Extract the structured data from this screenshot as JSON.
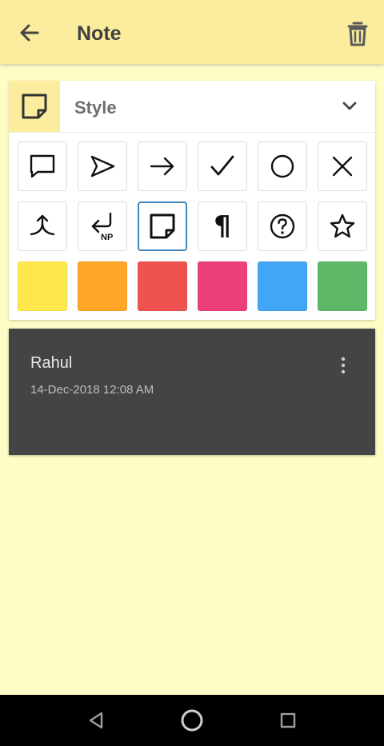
{
  "appbar": {
    "title": "Note",
    "back_icon": "arrow-left-icon",
    "delete_icon": "trash-icon"
  },
  "style_panel": {
    "label": "Style",
    "selected_icon": "sticky-note-icon",
    "icons_row1": [
      "speech-bubble-icon",
      "navigation-arrow-icon",
      "arrow-right-icon",
      "check-icon",
      "circle-icon",
      "close-icon"
    ],
    "icons_row2": [
      "merge-icon",
      "return-np-icon",
      "sticky-note-icon",
      "paragraph-icon",
      "question-circle-icon",
      "star-icon"
    ],
    "np_text": "NP",
    "pilcrow": "¶",
    "colors": [
      "#FFE84E",
      "#FFA629",
      "#EF5350",
      "#EC407A",
      "#42A5F5",
      "#5FB868"
    ]
  },
  "note": {
    "name": "Rahul",
    "date": "14-Dec-2018 12:08 AM"
  },
  "navbar": {
    "buttons": [
      "back-triangle-icon",
      "home-circle-icon",
      "recents-square-icon"
    ]
  }
}
